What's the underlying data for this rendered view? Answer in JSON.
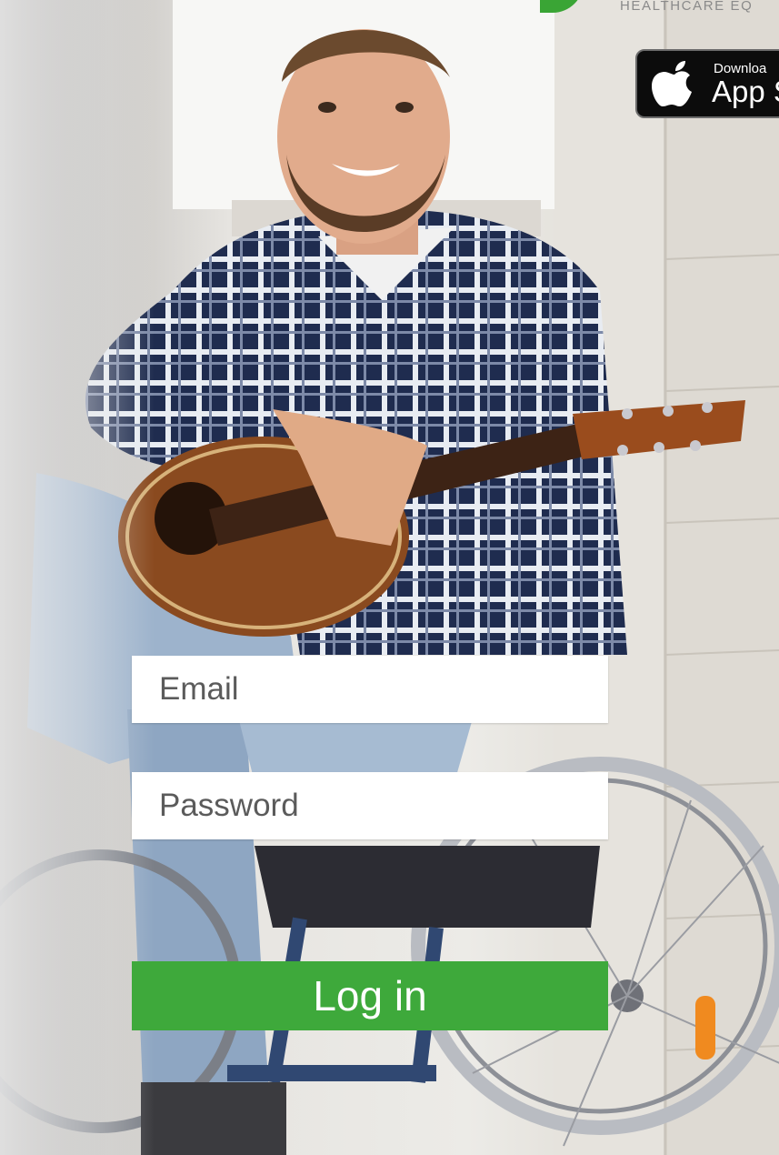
{
  "header": {
    "tagline": "HEALTHCARE EQ",
    "accent_color": "#3aa535"
  },
  "store_badge": {
    "icon": "apple-icon",
    "small_text": "Downloa",
    "big_text": "App S"
  },
  "login_form": {
    "email": {
      "placeholder": "Email",
      "value": ""
    },
    "password": {
      "placeholder": "Password",
      "value": ""
    },
    "submit_label": "Log in",
    "button_color": "#3ea93b"
  }
}
